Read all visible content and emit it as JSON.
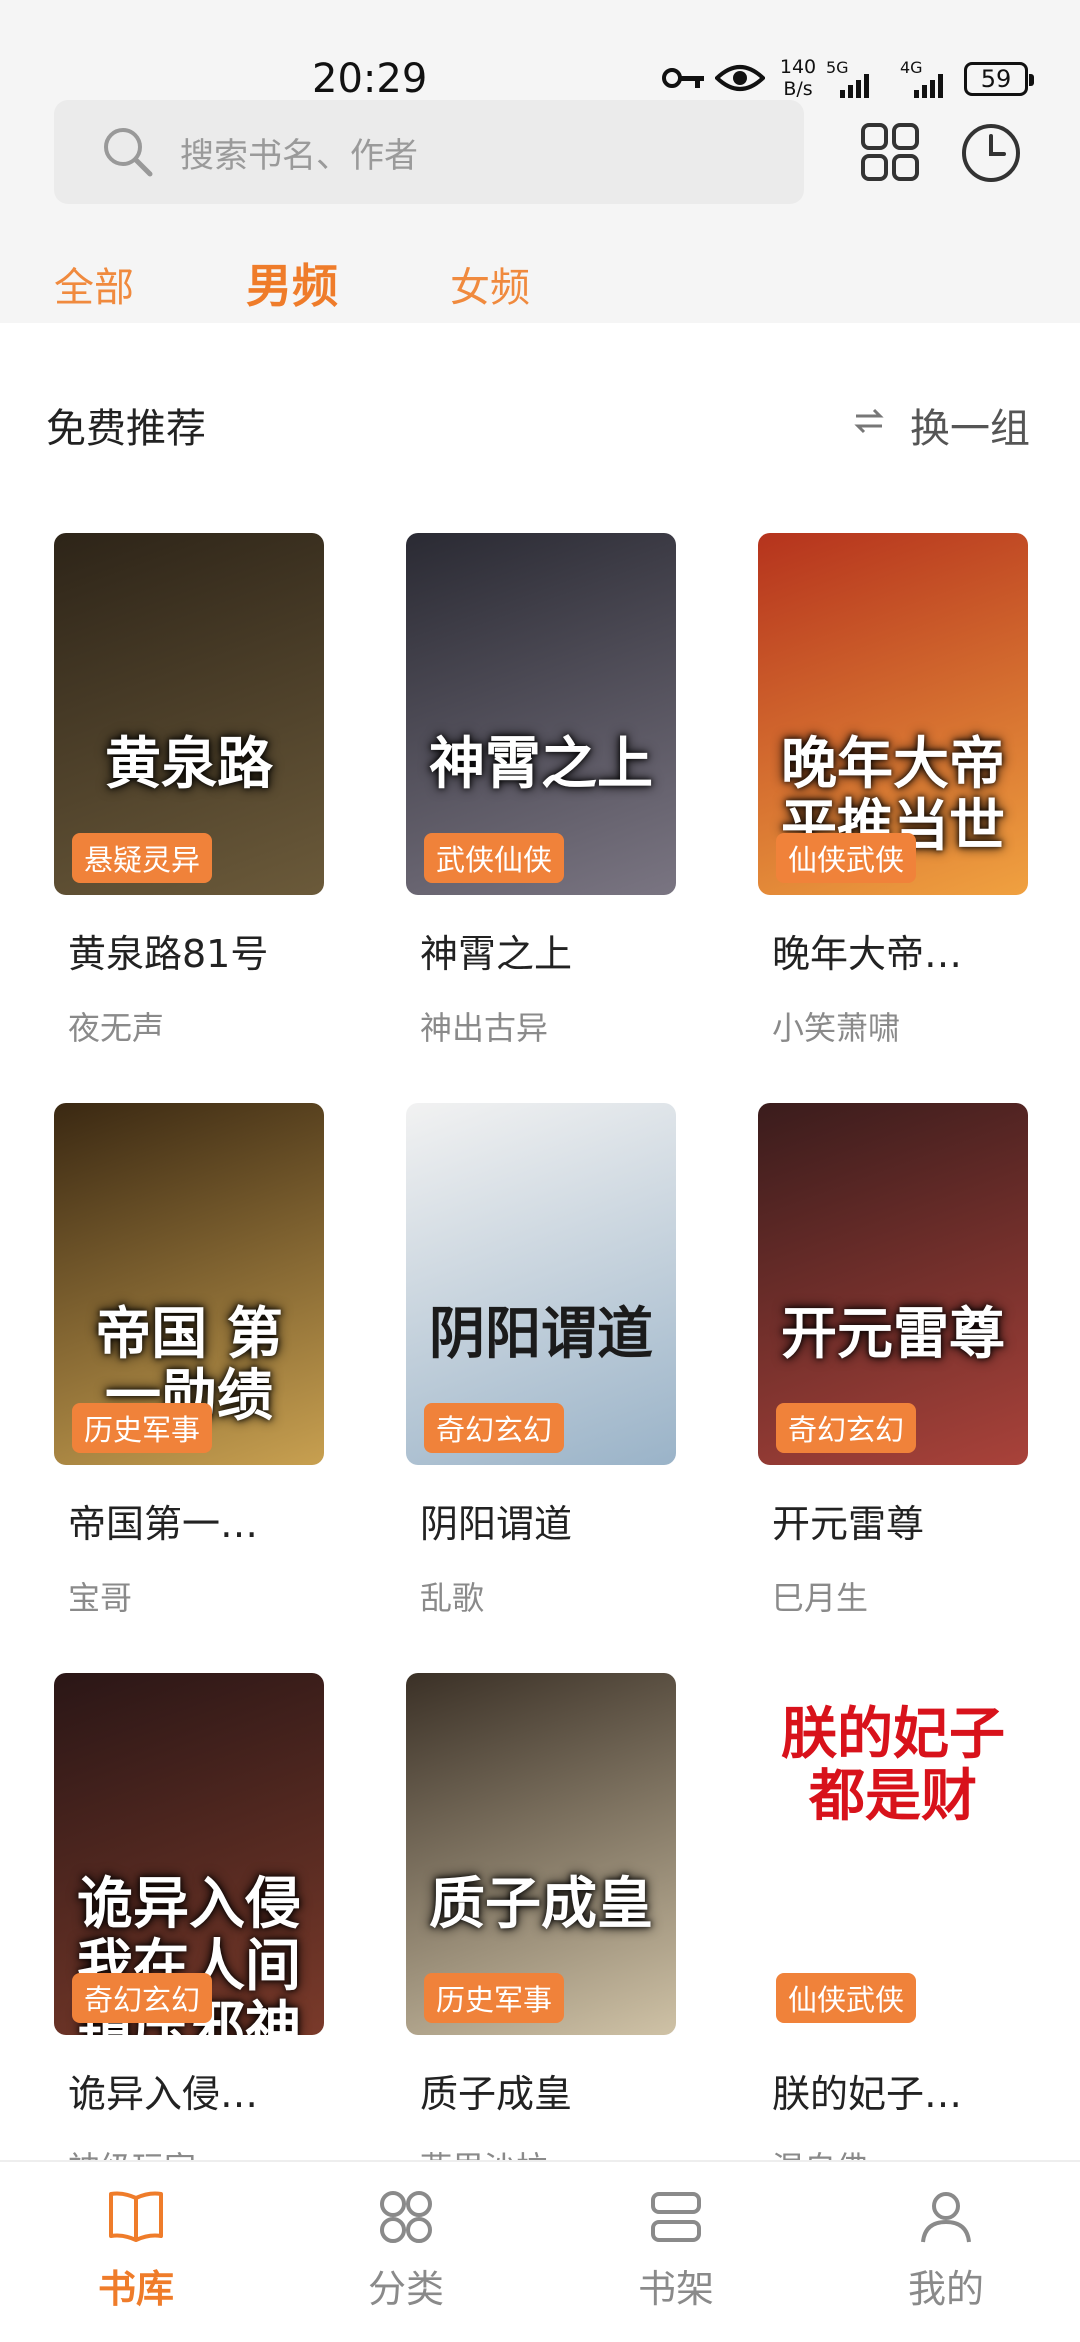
{
  "status": {
    "time": "20:29",
    "speed": "140\nB/s",
    "net1": "5G",
    "net2": "4G",
    "battery": "59"
  },
  "search": {
    "placeholder": "搜索书名、作者",
    "icon": "search-icon"
  },
  "header_icons": {
    "grid": "grid-icon",
    "history": "clock-icon"
  },
  "tabs": [
    {
      "label": "全部",
      "active": false
    },
    {
      "label": "男频",
      "active": true
    },
    {
      "label": "女频",
      "active": false
    }
  ],
  "section": {
    "title": "免费推荐",
    "refresh_label": "换一组",
    "refresh_icon": "swap-icon"
  },
  "books": [
    {
      "title": "黄泉路81号",
      "author": "夜无声",
      "tag": "悬疑灵异",
      "cover_text": "黄泉路",
      "colors": [
        "#2d2418",
        "#6b5a3a"
      ]
    },
    {
      "title": "神霄之上",
      "author": "神出古异",
      "tag": "武侠仙侠",
      "cover_text": "神霄之上",
      "colors": [
        "#2a2a33",
        "#7a7582"
      ]
    },
    {
      "title": "晚年大帝…",
      "author": "小笑萧啸",
      "tag": "仙侠武侠",
      "cover_text": "晚年大帝 平推当世",
      "colors": [
        "#b5331d",
        "#f0a140"
      ]
    },
    {
      "title": "帝国第一…",
      "author": "宝哥",
      "tag": "历史军事",
      "cover_text": "帝国 第一勋绩",
      "colors": [
        "#3a2812",
        "#c8a050"
      ]
    },
    {
      "title": "阴阳谓道",
      "author": "乱歌",
      "tag": "奇幻玄幻",
      "cover_text": "阴阳谓道",
      "colors": [
        "#f2f2f2",
        "#9ab3c8"
      ]
    },
    {
      "title": "开元雷尊",
      "author": "巳月生",
      "tag": "奇幻玄幻",
      "cover_text": "开元雷尊",
      "colors": [
        "#3a1c1c",
        "#a9423a"
      ]
    },
    {
      "title": "诡异入侵…",
      "author": "神级玩家",
      "tag": "奇幻玄幻",
      "cover_text": "诡异入侵 我在人间镇压邪神",
      "colors": [
        "#2a1616",
        "#7a3a2a"
      ]
    },
    {
      "title": "质子成皇",
      "author": "燕里沙拉",
      "tag": "历史军事",
      "cover_text": "质子成皇",
      "colors": [
        "#3a3026",
        "#cfc2a6"
      ]
    },
    {
      "title": "朕的妃子…",
      "author": "混自佛",
      "tag": "仙侠武侠",
      "cover_text": "朕的妃子都是财",
      "colors": [
        "#ffffff",
        "#ffffff"
      ]
    }
  ],
  "bottom_nav": [
    {
      "label": "书库",
      "icon": "book-icon",
      "active": true
    },
    {
      "label": "分类",
      "icon": "category-icon",
      "active": false
    },
    {
      "label": "书架",
      "icon": "bookshelf-icon",
      "active": false
    },
    {
      "label": "我的",
      "icon": "profile-icon",
      "active": false
    }
  ]
}
